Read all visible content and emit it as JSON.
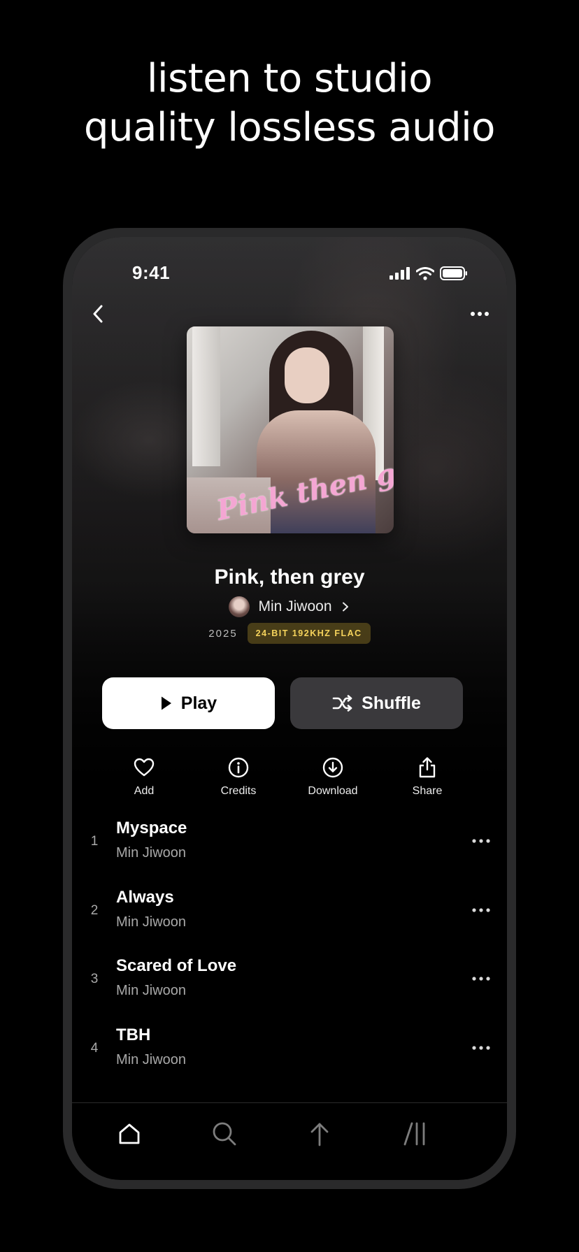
{
  "headline": {
    "line1": "listen to studio",
    "line2": "quality lossless audio"
  },
  "status_bar": {
    "time": "9:41"
  },
  "album": {
    "cover_art_text": "Pink then grey",
    "title": "Pink, then grey",
    "artist": "Min Jiwoon",
    "year": "2025",
    "quality_badge": "24-BIT 192KHZ FLAC"
  },
  "buttons": {
    "play": "Play",
    "shuffle": "Shuffle"
  },
  "actions": [
    {
      "label": "Add",
      "icon": "heart-icon"
    },
    {
      "label": "Credits",
      "icon": "info-icon"
    },
    {
      "label": "Download",
      "icon": "download-icon"
    },
    {
      "label": "Share",
      "icon": "share-icon"
    }
  ],
  "tracks": [
    {
      "number": "1",
      "title": "Myspace",
      "artist": "Min Jiwoon"
    },
    {
      "number": "2",
      "title": "Always",
      "artist": "Min Jiwoon"
    },
    {
      "number": "3",
      "title": "Scared of Love",
      "artist": "Min Jiwoon"
    },
    {
      "number": "4",
      "title": "TBH",
      "artist": "Min Jiwoon"
    }
  ],
  "tab_bar": [
    {
      "icon": "home-icon",
      "active": true
    },
    {
      "icon": "search-icon",
      "active": false
    },
    {
      "icon": "upload-arrow-icon",
      "active": false
    },
    {
      "icon": "library-icon",
      "active": false
    }
  ],
  "colors": {
    "background": "#000000",
    "quality_badge_text": "#f6d35c",
    "quality_badge_bg": "#5c4e1c",
    "shuffle_bg": "#3a393c",
    "secondary_text": "#a8a8a8"
  }
}
